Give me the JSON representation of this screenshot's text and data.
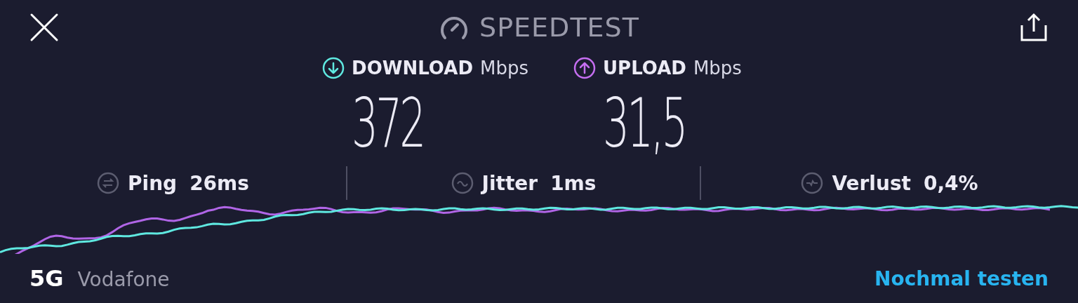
{
  "header": {
    "title": "SPEEDTEST"
  },
  "speeds": [
    {
      "kind": "download",
      "label": "DOWNLOAD",
      "unit": "Mbps",
      "value": "372"
    },
    {
      "kind": "upload",
      "label": "UPLOAD",
      "unit": "Mbps",
      "value": "31,5"
    }
  ],
  "stats": [
    {
      "kind": "ping",
      "label": "Ping",
      "value": "26ms"
    },
    {
      "kind": "jitter",
      "label": "Jitter",
      "value": "1ms"
    },
    {
      "kind": "loss",
      "label": "Verlust",
      "value": "0,4%"
    }
  ],
  "footer": {
    "network": "5G",
    "provider": "Vodafone",
    "retry": "Nochmal testen"
  }
}
